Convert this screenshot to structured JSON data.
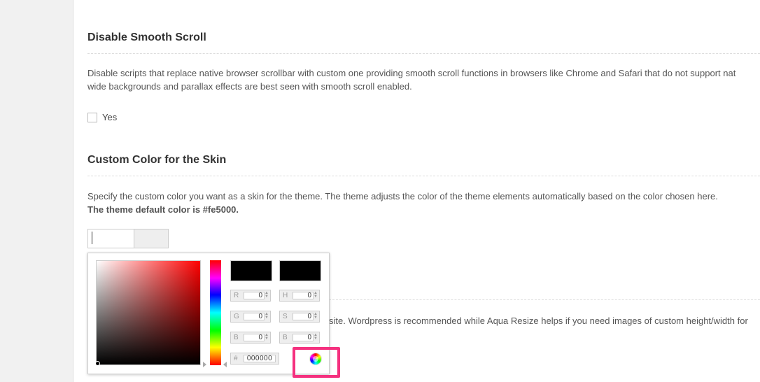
{
  "sections": {
    "smooth_scroll": {
      "title": "Disable Smooth Scroll",
      "desc_line1": "Disable scripts that replace native browser scrollbar with custom one providing smooth scroll functions in browsers like Chrome and Safari that do not support nat",
      "desc_line2": "wide backgrounds and parallax effects are best seen with smooth scroll enabled.",
      "checkbox_label": "Yes",
      "checked": false
    },
    "custom_color": {
      "title": "Custom Color for the Skin",
      "desc_line1": "Specify the custom color you want as a skin for the theme. The theme adjusts the color of the theme elements automatically based on the color chosen here.",
      "desc_line2": "The theme default color is #fe5000.",
      "input_value": ""
    },
    "next_section": {
      "desc_partial": "site. Wordpress is recommended while Aqua Resize helps if you need images of custom height/width for"
    }
  },
  "color_picker": {
    "new_color": "#000000",
    "current_color": "#000000",
    "fields": {
      "r_label": "R",
      "r_value": "0",
      "g_label": "G",
      "g_value": "0",
      "b_label": "B",
      "b_value": "0",
      "h_label": "H",
      "h_value": "0",
      "s_label": "S",
      "s_value": "0",
      "br_label": "B",
      "br_value": "0",
      "hex_label": "#",
      "hex_value": "000000"
    },
    "submit_icon": "color-wheel-icon"
  },
  "colors": {
    "highlight": "#f5317f",
    "sidebar": "#f1f1f1"
  }
}
